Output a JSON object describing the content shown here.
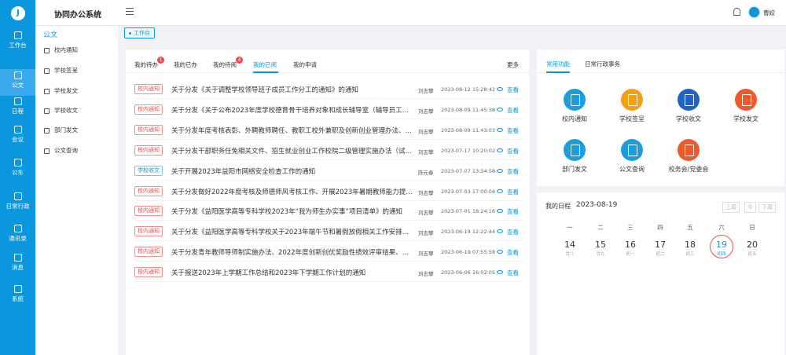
{
  "app": {
    "title": "协同办公系统",
    "user": "曹姣"
  },
  "rail": [
    {
      "label": "工作台",
      "icon": "home-icon"
    },
    {
      "label": "公文",
      "icon": "book-icon",
      "active": true
    },
    {
      "label": "日程",
      "icon": "calendar-icon"
    },
    {
      "label": "会议",
      "icon": "meeting-icon"
    },
    {
      "label": "公车",
      "icon": "car-icon"
    },
    {
      "label": "日常行政",
      "icon": "admin-icon"
    },
    {
      "label": "通讯录",
      "icon": "contacts-icon"
    },
    {
      "label": "消息",
      "icon": "message-icon"
    },
    {
      "label": "系统",
      "icon": "settings-icon"
    }
  ],
  "sidenav": {
    "heading": "公文",
    "items": [
      {
        "label": "校内通知",
        "icon": "book-icon"
      },
      {
        "label": "学校签呈",
        "icon": "document-icon"
      },
      {
        "label": "学校发文",
        "icon": "send-icon"
      },
      {
        "label": "学校收文",
        "icon": "inbox-icon"
      },
      {
        "label": "部门发文",
        "icon": "file-icon"
      },
      {
        "label": "公文查询",
        "icon": "search-doc-icon"
      }
    ]
  },
  "breadcrumb_tag": "工作台",
  "docs": {
    "tabs": [
      {
        "label": "我的待办",
        "badge": "1"
      },
      {
        "label": "我的已办",
        "badge": ""
      },
      {
        "label": "我的待阅",
        "badge": "4"
      },
      {
        "label": "我的已阅",
        "badge": "",
        "active": true
      },
      {
        "label": "我的申请",
        "badge": ""
      }
    ],
    "more": "更多",
    "view_label": "查看",
    "rows": [
      {
        "category": "校内通知",
        "title": "关于分发《关于调整学校领导班子成员工作分工的通知》的通知",
        "author": "刘志攀",
        "date": "2023-08-12 15:28:42"
      },
      {
        "category": "校内通知",
        "title": "关于分发《关于公布2023年度学校德育骨干培养对象和成长辅导室（辅导员工作…",
        "author": "刘志攀",
        "date": "2023-08-09 11:45:38"
      },
      {
        "category": "校内通知",
        "title": "关于分发年度考核表彰、外聘教师聘任、教职工校外兼职及创新创业管理办法、“…",
        "author": "刘志攀",
        "date": "2023-08-09 11:43:03"
      },
      {
        "category": "校内通知",
        "title": "关于分发干部职务任免相关文件、招生就业创业工作校院二级管理实施办法（试行…",
        "author": "刘志攀",
        "date": "2023-07-17 10:20:02"
      },
      {
        "category": "学校收文",
        "title": "关于开展2023年益阳市网络安全检查工作的通知",
        "author": "陈元春",
        "date": "2023-07-07 13:34:58"
      },
      {
        "category": "校内通知",
        "title": "关于分发做好2022年度考核及师德师风考核工作、开展2023年暑期教师能力提升…",
        "author": "刘志攀",
        "date": "2023-07-03 17:00:04"
      },
      {
        "category": "校内通知",
        "title": "关于分发《益阳医学高等专科学校2023年“我为师生办实事”项目清单》的通知",
        "author": "刘志攀",
        "date": "2023-07-01 18:24:16"
      },
      {
        "category": "校内通知",
        "title": "关于分发《益阳医学高等专科学校关于2023年端午节和暑假放假相关工作安排的…",
        "author": "刘志攀",
        "date": "2023-06-19 12:22:44"
      },
      {
        "category": "校内通知",
        "title": "关于分发青年教师导师制实施办法、2022年度创新创优奖励性绩效评审结果、开…",
        "author": "刘志攀",
        "date": "2023-06-19 07:55:58"
      },
      {
        "category": "校内通知",
        "title": "关于报送2023年上学期工作总结和2023年下学期工作计划的通知",
        "author": "刘志攀",
        "date": "2023-06-06 16:02:05"
      }
    ]
  },
  "functions": {
    "tabs": [
      {
        "label": "常用功能",
        "active": true
      },
      {
        "label": "日常行政事务"
      }
    ],
    "items": [
      {
        "label": "校内通知",
        "color": "#1b9ee0",
        "icon": "notice-icon"
      },
      {
        "label": "学校签呈",
        "color": "#f5a011",
        "icon": "sign-icon"
      },
      {
        "label": "学校收文",
        "color": "#1d63c9",
        "icon": "receive-doc-icon"
      },
      {
        "label": "学校发文",
        "color": "#f05a2b",
        "icon": "send-doc-icon"
      },
      {
        "label": "部门发文",
        "color": "#1b9ee0",
        "icon": "dept-doc-icon"
      },
      {
        "label": "公文查询",
        "color": "#1b9ee0",
        "icon": "query-icon"
      },
      {
        "label": "校务会/党委会",
        "color": "#f05a2b",
        "icon": "meeting-icon"
      }
    ]
  },
  "calendar": {
    "title": "我的日程",
    "date": "2023-08-19",
    "buttons": [
      "上周",
      "今",
      "下周"
    ],
    "weekdays": [
      "一",
      "二",
      "三",
      "四",
      "五",
      "六",
      "日"
    ],
    "days": [
      {
        "num": "14",
        "lunar": "廿八"
      },
      {
        "num": "15",
        "lunar": "廿九"
      },
      {
        "num": "16",
        "lunar": "初一"
      },
      {
        "num": "17",
        "lunar": "初二"
      },
      {
        "num": "18",
        "lunar": "初三"
      },
      {
        "num": "19",
        "lunar": "初四",
        "today": true
      },
      {
        "num": "20",
        "lunar": "初五"
      }
    ]
  }
}
